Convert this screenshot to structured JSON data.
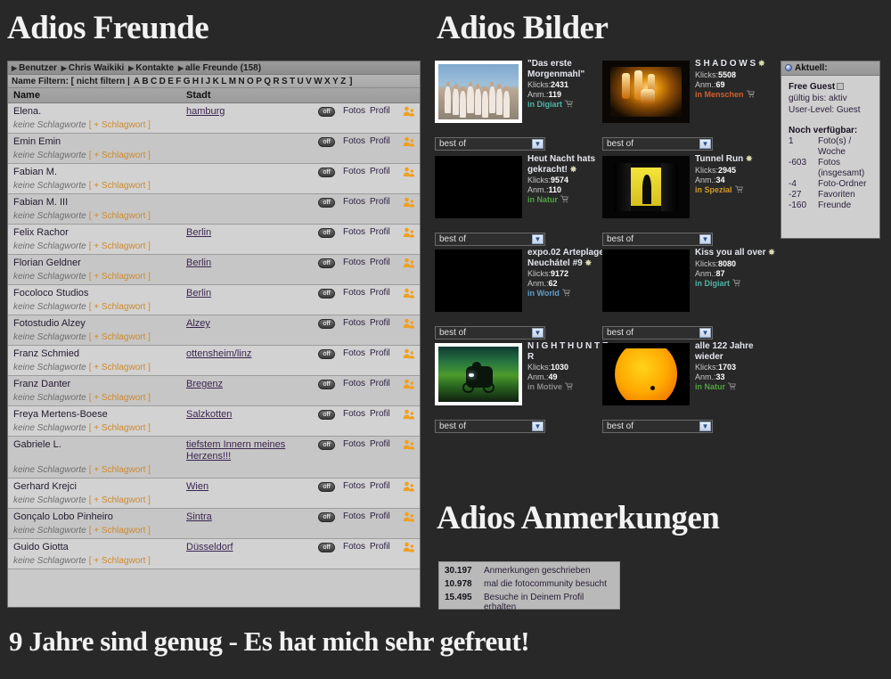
{
  "headings": {
    "freunde": "Adios Freunde",
    "bilder": "Adios Bilder",
    "anmerkungen": "Adios Anmerkungen",
    "tagline": "9 Jahre sind genug - Es hat mich sehr gefreut!"
  },
  "friends_panel": {
    "breadcrumb": [
      "Benutzer",
      "Chris Waikiki",
      "Kontakte",
      "alle Freunde (158)"
    ],
    "filter_label": "Name Filtern:",
    "filter_nofilter": "[ nicht filtern |",
    "filter_letters": [
      "A",
      "B",
      "C",
      "D",
      "E",
      "F",
      "G",
      "H",
      "I",
      "J",
      "K",
      "L",
      "M",
      "N",
      "O",
      "P",
      "Q",
      "R",
      "S",
      "T",
      "U",
      "V",
      "W",
      "X",
      "Y",
      "Z"
    ],
    "filter_close": "]",
    "columns": {
      "name": "Name",
      "stadt": "Stadt"
    },
    "row_actions": {
      "toggle": "off",
      "fotos": "Fotos",
      "profil": "Profil"
    },
    "tags_none": "keine Schlagworte",
    "tags_add": "[ + Schlagwort ]",
    "rows": [
      {
        "name": "Elena.",
        "city": "hamburg"
      },
      {
        "name": "Emin Emin",
        "city": ""
      },
      {
        "name": "Fabian M.",
        "city": ""
      },
      {
        "name": "Fabian M. III",
        "city": ""
      },
      {
        "name": "Felix Rachor",
        "city": "Berlin"
      },
      {
        "name": "Florian Geldner",
        "city": "Berlin"
      },
      {
        "name": "Focoloco Studios",
        "city": "Berlin"
      },
      {
        "name": "Fotostudio Alzey",
        "city": "Alzey"
      },
      {
        "name": "Franz Schmied",
        "city": "ottensheim/linz"
      },
      {
        "name": "Franz Danter",
        "city": "Bregenz"
      },
      {
        "name": "Freya Mertens-Boese",
        "city": "Salzkotten"
      },
      {
        "name": "Gabriele L.",
        "city": "tiefstem Innern meines Herzens!!!"
      },
      {
        "name": "Gerhard Krejci",
        "city": "Wien"
      },
      {
        "name": "Gonçalo Lobo Pinheiro",
        "city": "Sintra"
      },
      {
        "name": "Guido Giotta",
        "city": "Düsseldorf"
      }
    ]
  },
  "photos": {
    "select_value": "best of",
    "clicks_label": "Klicks:",
    "anm_label": "Anm.:",
    "cards": [
      {
        "title": "\"Das erste Morgenmahl\"",
        "starred": false,
        "clicks": "2431",
        "anm": "119",
        "category": "in Digiart",
        "cat_color": "#4fb3a6",
        "thumb": "group-white-dresses"
      },
      {
        "title": "S H A D O W S",
        "starred": true,
        "clicks": "5508",
        "anm": "69",
        "category": "in Menschen",
        "cat_color": "#d0602c",
        "thumb": "amber-lights"
      },
      {
        "title": "Heut Nacht hats gekracht!",
        "starred": true,
        "clicks": "9574",
        "anm": "110",
        "category": "in Natur",
        "cat_color": "#4fa33f",
        "thumb": "lightning-storm"
      },
      {
        "title": "Tunnel Run",
        "starred": true,
        "clicks": "2945",
        "anm": "34",
        "category": "in Spezial",
        "cat_color": "#d09a28",
        "thumb": "yellow-tunnel"
      },
      {
        "title": "expo.02 Arteplage Neuchátel #9",
        "starred": true,
        "clicks": "9172",
        "anm": "62",
        "category": "in World",
        "cat_color": "#5e9ec9",
        "thumb": "green-grass-sky"
      },
      {
        "title": "Kiss you all over",
        "starred": true,
        "clicks": "8080",
        "anm": "87",
        "category": "in Digiart",
        "cat_color": "#4fb3a6",
        "thumb": "red-cloth-figure"
      },
      {
        "title": "N I G H T H U N T E R",
        "starred": false,
        "clicks": "1030",
        "anm": "49",
        "category": "in Motive",
        "cat_color": "#8a8a8a",
        "thumb": "night-rider-green"
      },
      {
        "title": "alle 122 Jahre wieder",
        "starred": false,
        "clicks": "1703",
        "anm": "33",
        "category": "in Natur",
        "cat_color": "#4fa33f",
        "thumb": "orange-sun-transit"
      }
    ]
  },
  "aktuell": {
    "title": "Aktuell:",
    "account_type": "Free Guest",
    "valid_until": "gültig bis: aktiv",
    "user_level": "User-Level: Guest",
    "available_title": "Noch verfügbar:",
    "available": [
      {
        "num": "1",
        "label": "Foto(s) / Woche"
      },
      {
        "num": "-603",
        "label": "Fotos (insgesamt)"
      },
      {
        "num": "-4",
        "label": "Foto-Ordner"
      },
      {
        "num": "-27",
        "label": "Favoriten"
      },
      {
        "num": "-160",
        "label": "Freunde"
      }
    ]
  },
  "stats": [
    {
      "num": "30.197",
      "text": "Anmerkungen geschrieben"
    },
    {
      "num": "10.978",
      "text": "mal die fotocommunity besucht"
    },
    {
      "num": "15.495",
      "text": "Besuche in Deinem Profil erhalten"
    }
  ]
}
